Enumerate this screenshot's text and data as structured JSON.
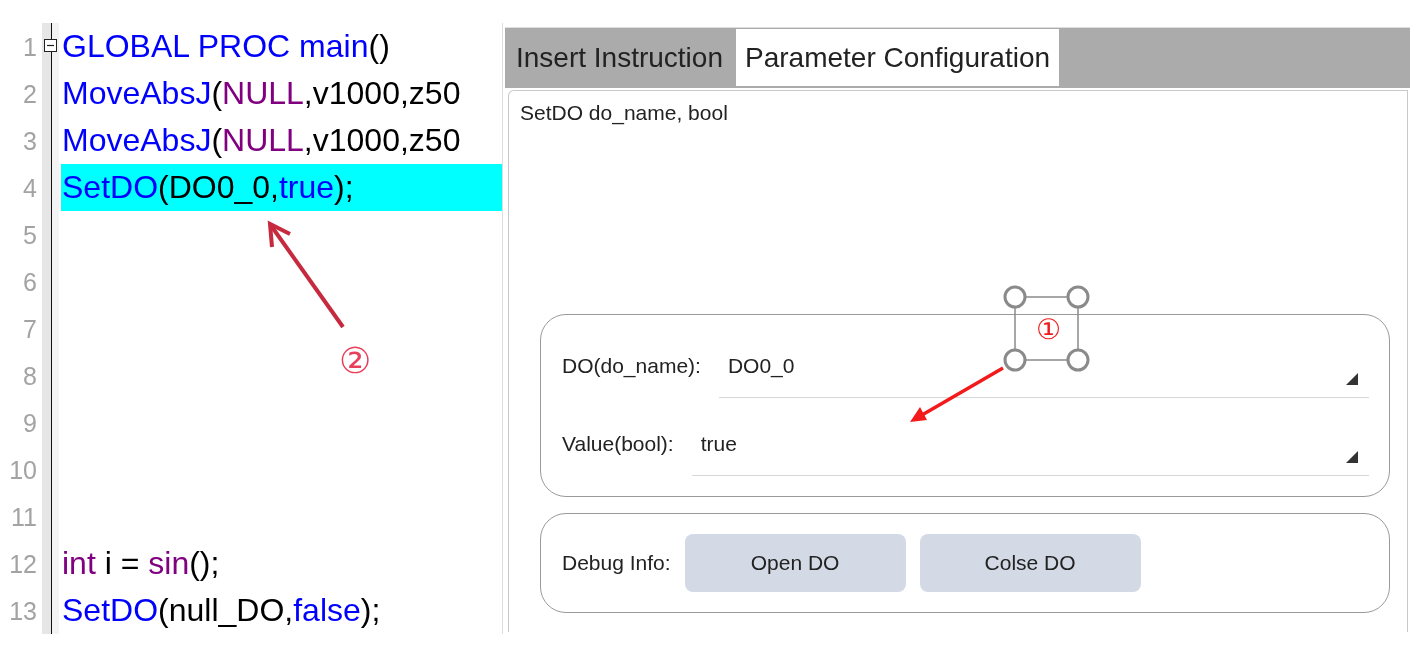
{
  "editor": {
    "lines": [
      {
        "number": "1",
        "selected": false,
        "expanded": true,
        "tokens": [
          {
            "text": "GLOBAL PROC main",
            "kind": "keyword"
          },
          {
            "text": "()",
            "kind": "plain"
          }
        ]
      },
      {
        "number": "2",
        "selected": false,
        "tokens": [
          {
            "text": "MoveAbsJ",
            "kind": "keyword"
          },
          {
            "text": "(",
            "kind": "plain"
          },
          {
            "text": "NULL",
            "kind": "builtin"
          },
          {
            "text": ",v1000,z50",
            "kind": "plain"
          }
        ]
      },
      {
        "number": "3",
        "selected": false,
        "tokens": [
          {
            "text": "MoveAbsJ",
            "kind": "keyword"
          },
          {
            "text": "(",
            "kind": "plain"
          },
          {
            "text": "NULL",
            "kind": "builtin"
          },
          {
            "text": ",v1000,z50",
            "kind": "plain"
          }
        ]
      },
      {
        "number": "4",
        "selected": true,
        "tokens": [
          {
            "text": "SetDO",
            "kind": "keyword"
          },
          {
            "text": "(DO0_0,",
            "kind": "plain"
          },
          {
            "text": "true",
            "kind": "keyword"
          },
          {
            "text": ");",
            "kind": "plain"
          }
        ]
      },
      {
        "number": "5",
        "selected": false
      },
      {
        "number": "6",
        "selected": false
      },
      {
        "number": "7",
        "selected": false
      },
      {
        "number": "8",
        "selected": false
      },
      {
        "number": "9",
        "selected": false
      },
      {
        "number": "10",
        "selected": false
      },
      {
        "number": "11",
        "selected": false
      },
      {
        "number": "12",
        "selected": false,
        "tokens": [
          {
            "text": "int",
            "kind": "builtin"
          },
          {
            "text": " i = ",
            "kind": "plain"
          },
          {
            "text": "sin",
            "kind": "builtin"
          },
          {
            "text": "();",
            "kind": "plain"
          }
        ]
      },
      {
        "number": "13",
        "selected": false,
        "tokens": [
          {
            "text": "SetDO",
            "kind": "keyword"
          },
          {
            "text": "(null_DO,",
            "kind": "plain"
          },
          {
            "text": "false",
            "kind": "keyword"
          },
          {
            "text": ");",
            "kind": "plain"
          }
        ]
      }
    ]
  },
  "panel": {
    "tabs": [
      {
        "label": "Insert Instruction",
        "selected": false
      },
      {
        "label": "Parameter Configuration",
        "selected": true
      }
    ],
    "signature": "SetDO do_name, bool",
    "parameters": [
      {
        "label": "DO(do_name):",
        "value": "DO0_0"
      },
      {
        "label": "Value(bool):",
        "value": "true"
      }
    ],
    "debug": {
      "label": "Debug Info:",
      "buttons": [
        "Open DO",
        "Colse DO"
      ]
    }
  },
  "annotations": [
    {
      "label": "②",
      "kind": "plain"
    },
    {
      "label": "①",
      "kind": "framed"
    }
  ]
}
